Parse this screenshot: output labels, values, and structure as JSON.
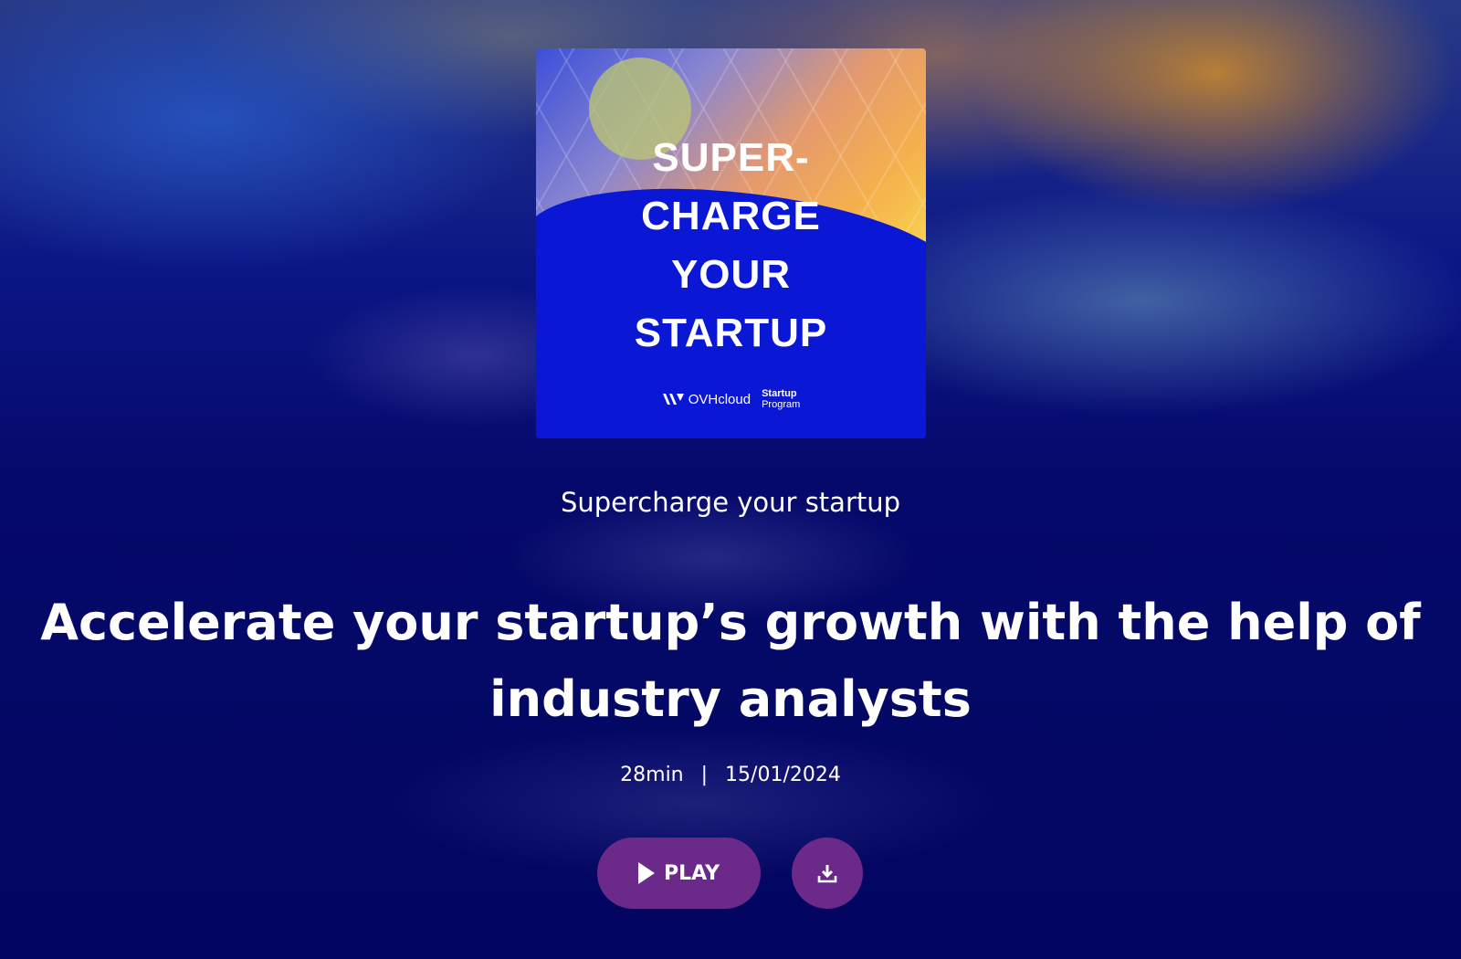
{
  "cover": {
    "title_lines": [
      "SUPER-",
      "CHARGE",
      "YOUR",
      "STARTUP"
    ],
    "brand": "OVHcloud",
    "program_line1": "Startup",
    "program_line2": "Program"
  },
  "podcast_name": "Supercharge your startup",
  "episode_title": "Accelerate your startup’s growth with the help of industry analysts",
  "duration": "28min",
  "separator": "|",
  "date": "15/01/2024",
  "play_label": "PLAY",
  "icons": {
    "play": "play-icon",
    "download": "download-icon"
  },
  "colors": {
    "background": "#03075f",
    "button": "#6b2a8a",
    "cover_blue": "#0a17d4"
  }
}
